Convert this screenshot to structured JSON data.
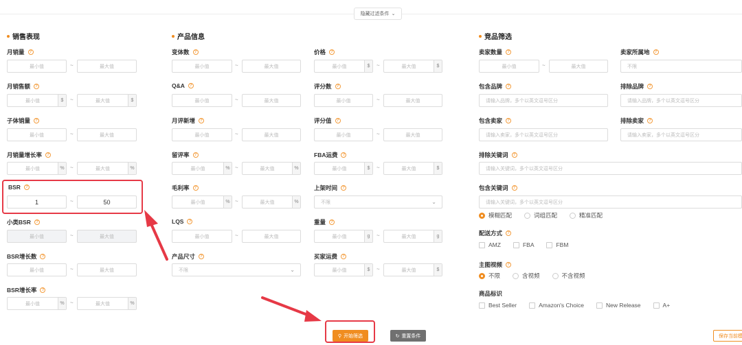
{
  "toggle": {
    "label": "隐藏过滤条件",
    "icon": "chevron-down-icon"
  },
  "sections": {
    "sales": "销售表现",
    "product": "产品信息",
    "competitor": "竞品筛选"
  },
  "placeholders": {
    "min": "最小值",
    "max": "最大值",
    "dash": "~",
    "unlimited": "不限",
    "multi_brand": "请输入品牌，多个以英文逗号区分",
    "multi_seller": "请输入卖家，多个以英文逗号区分",
    "multi_keyword": "请输入关键词，多个以英文逗号区分"
  },
  "suffix": {
    "dollar": "$",
    "percent": "%",
    "gram": "g"
  },
  "sales": {
    "monthly_sales": "月销量",
    "monthly_revenue": "月销售额",
    "child_sales": "子体销量",
    "sales_growth": "月销量增长率",
    "bsr": "BSR",
    "bsr_min": "1",
    "bsr_max": "50",
    "sub_bsr": "小类BSR",
    "bsr_growth_count": "BSR增长数",
    "bsr_growth_rate": "BSR增长率"
  },
  "product": {
    "variants": "变体数",
    "qa": "Q&A",
    "new_reviews": "月评新增",
    "review_rate": "留评率",
    "margin": "毛利率",
    "lqs": "LQS",
    "size": "产品尺寸",
    "price": "价格",
    "review_count": "评分数",
    "rating": "评分值",
    "fba_fee": "FBA运费",
    "listing_date": "上架时间",
    "weight": "重量",
    "buyer_freight": "买家运费"
  },
  "competitor": {
    "seller_count": "卖家数量",
    "seller_location": "卖家所属地",
    "include_brand": "包含品牌",
    "exclude_brand": "排除品牌",
    "include_seller": "包含卖家",
    "exclude_seller": "排除卖家",
    "exclude_keyword": "排除关键词",
    "include_keyword": "包含关键词",
    "match_options": [
      "模糊匹配",
      "词组匹配",
      "精准匹配"
    ],
    "delivery": "配送方式",
    "delivery_options": [
      "AMZ",
      "FBA",
      "FBM"
    ],
    "video": "主图视频",
    "video_options": [
      "不限",
      "含视频",
      "不含视频"
    ],
    "badge": "商品标识",
    "badge_options": [
      "Best Seller",
      "Amazon's Choice",
      "New Release",
      "A+"
    ]
  },
  "buttons": {
    "search": "开始筛选",
    "reset": "重置条件",
    "save": "保存当前模"
  },
  "colors": {
    "accent": "#f08d20",
    "highlight": "#e63946",
    "reset_bg": "#707070"
  }
}
